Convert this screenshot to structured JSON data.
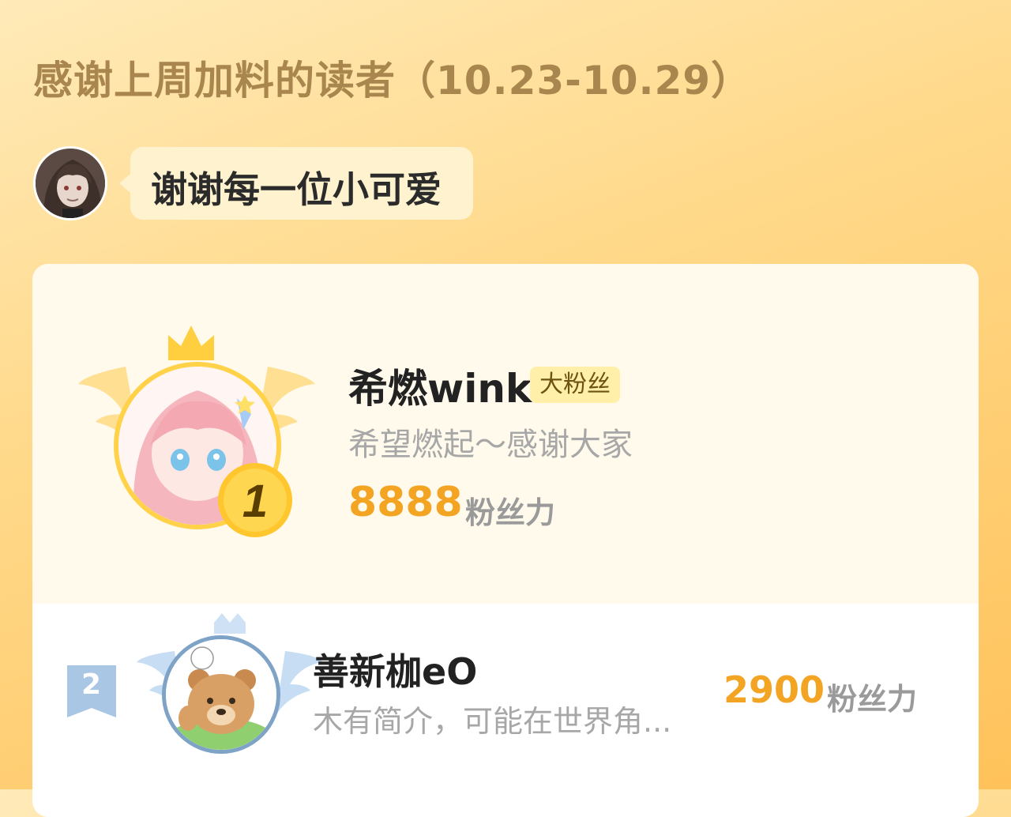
{
  "header": {
    "title": "感谢上周加料的读者（10.23-10.29）"
  },
  "host": {
    "message": "谢谢每一位小可爱"
  },
  "leaderboard": {
    "first": {
      "rank": "1",
      "name": "希燃wink",
      "tag": "大粉丝",
      "bio": "希望燃起～感谢大家",
      "score": "8888",
      "unit": "粉丝力"
    },
    "second": {
      "rank": "2",
      "name": "善新枷eO",
      "bio": "木有简介，可能在世界角...",
      "score": "2900",
      "unit": "粉丝力"
    }
  },
  "colors": {
    "title": "#a8864e",
    "score": "#f3a423",
    "gold": "#ffd24a",
    "silver": "#7ea3c7"
  }
}
